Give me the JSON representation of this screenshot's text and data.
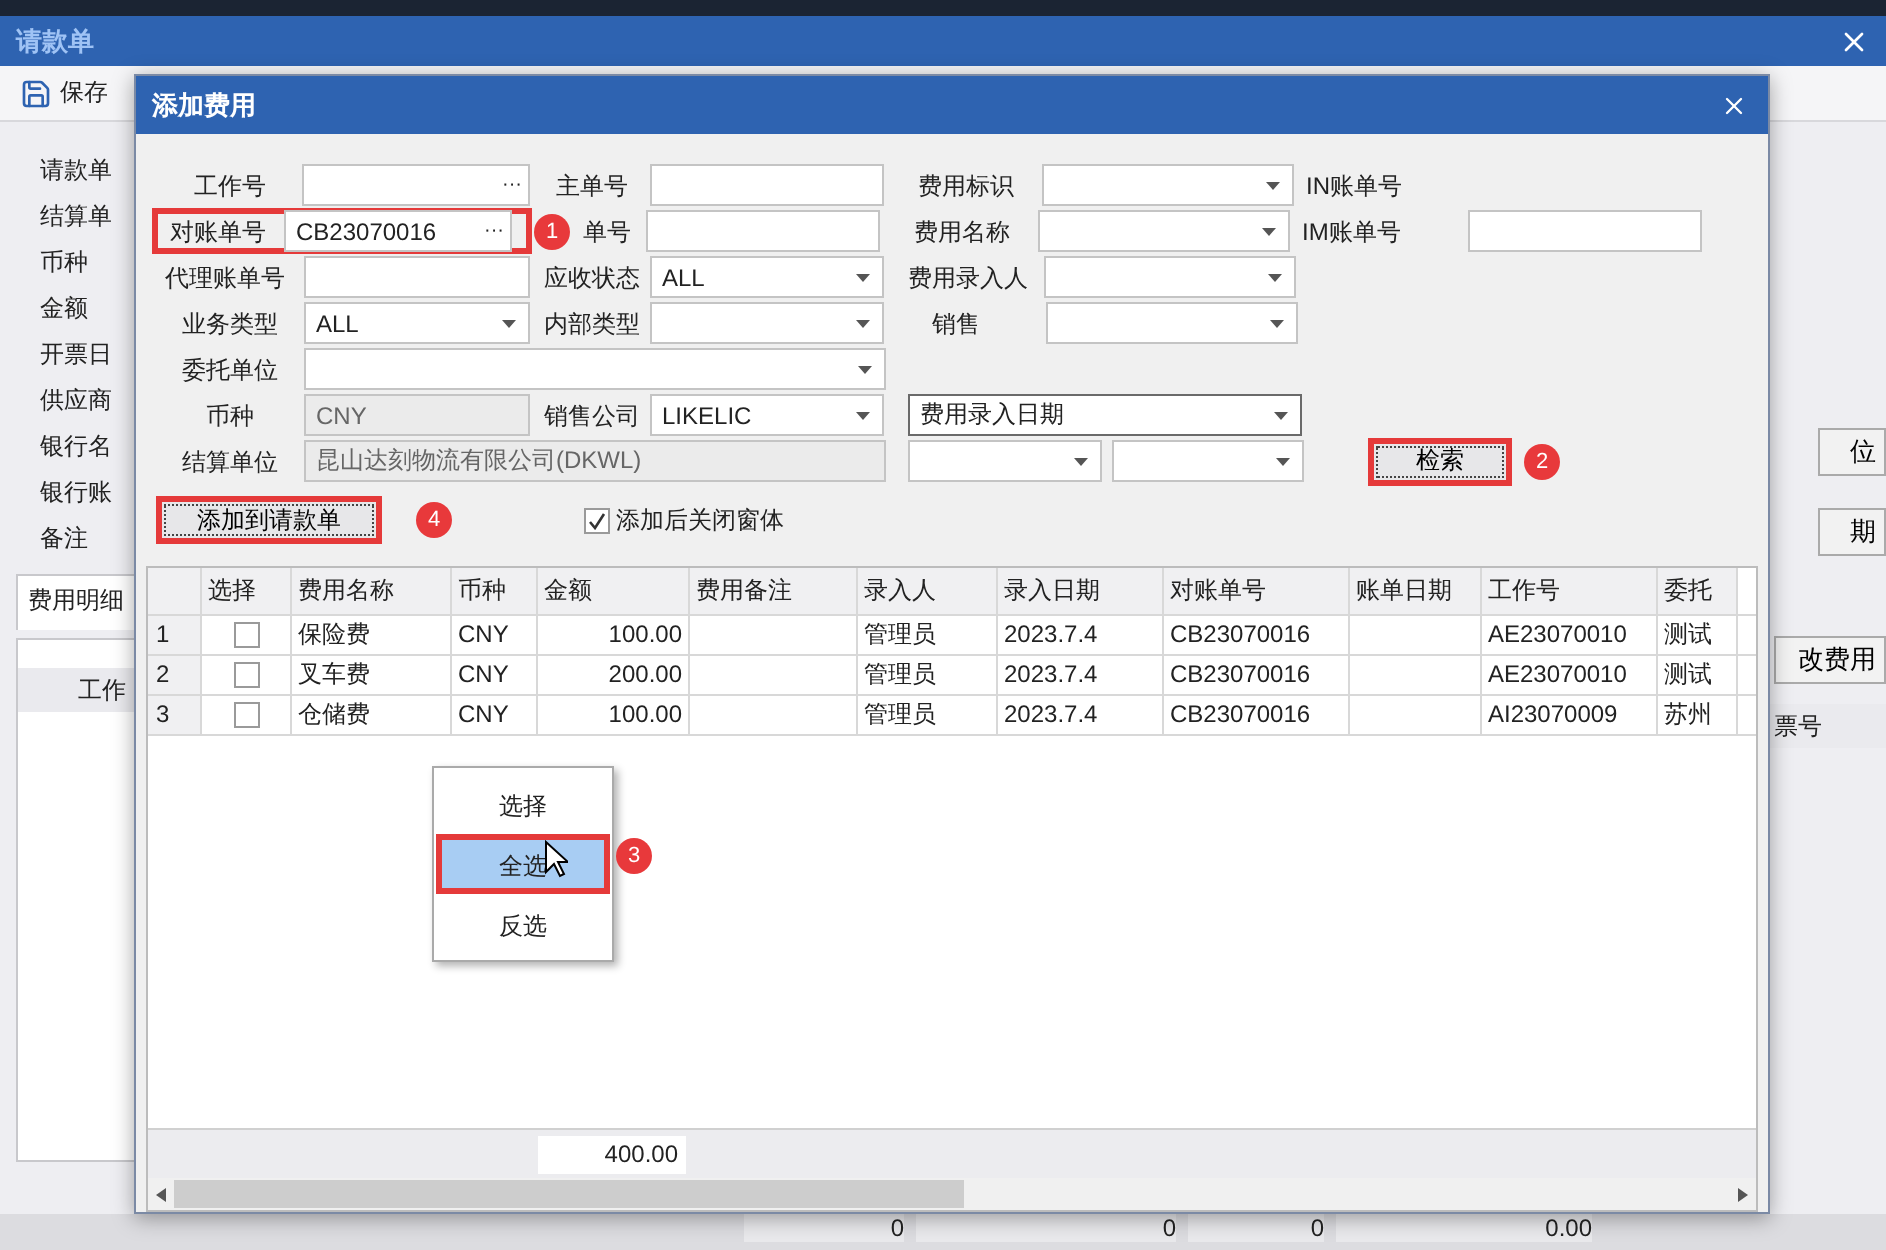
{
  "window": {
    "title": "请款单"
  },
  "toolbar": {
    "save_label": "保存"
  },
  "form_labels": [
    "请款单",
    "结算单",
    "币种",
    "金额",
    "开票日",
    "供应商",
    "银行名",
    "银行账",
    "备注"
  ],
  "side_buttons": [
    "位",
    "期"
  ],
  "tabs": [
    {
      "label": "费用明细",
      "selected": true
    }
  ],
  "modify_button": "改费用",
  "detail_columns": [
    "工作",
    "票号"
  ],
  "totals": [
    "0",
    "0",
    "0",
    "0.00"
  ],
  "dialog": {
    "title": "添加费用",
    "rows": [
      [
        {
          "kind": "label",
          "text": "工作号"
        },
        {
          "kind": "lookup",
          "button": "···"
        },
        {
          "kind": "label",
          "text": "主单号"
        },
        {
          "kind": "text"
        },
        {
          "kind": "label",
          "text": "费用标识"
        },
        {
          "kind": "combo"
        },
        {
          "kind": "label",
          "text": "IN账单号"
        }
      ],
      [
        {
          "kind": "group",
          "highlight": true,
          "children": [
            {
              "kind": "label",
              "text": "对账单号"
            },
            {
              "kind": "lookup",
              "value": "CB23070016",
              "button": "···"
            }
          ]
        },
        {
          "kind": "marker",
          "text": "1"
        },
        {
          "kind": "label",
          "text": "单号"
        },
        {
          "kind": "text"
        },
        {
          "kind": "label",
          "text": "费用名称"
        },
        {
          "kind": "combo"
        },
        {
          "kind": "label",
          "text": "IM账单号"
        },
        {
          "kind": "text"
        }
      ],
      [
        {
          "kind": "label",
          "text": "代理账单号"
        },
        {
          "kind": "text"
        },
        {
          "kind": "label",
          "text": "应收状态"
        },
        {
          "kind": "combo",
          "value": "ALL"
        },
        {
          "kind": "label",
          "text": "费用录入人"
        },
        {
          "kind": "combo"
        }
      ],
      [
        {
          "kind": "label",
          "text": "业务类型"
        },
        {
          "kind": "combo",
          "value": "ALL"
        },
        {
          "kind": "label",
          "text": "内部类型"
        },
        {
          "kind": "combo"
        },
        {
          "kind": "label",
          "text": "销售"
        },
        {
          "kind": "combo"
        }
      ],
      [
        {
          "kind": "label",
          "text": "委托单位"
        },
        {
          "kind": "combo"
        }
      ],
      [
        {
          "kind": "label",
          "text": "币种"
        },
        {
          "kind": "text",
          "value": "CNY",
          "disabled": true
        },
        {
          "kind": "label",
          "text": "销售公司"
        },
        {
          "kind": "combo",
          "value": "LIKELIC"
        },
        {
          "kind": "dropdown",
          "value": "费用录入日期"
        }
      ],
      [
        {
          "kind": "label",
          "text": "结算单位"
        },
        {
          "kind": "combo",
          "value": "昆山达刻物流有限公司(DKWL)",
          "disabled": true
        },
        {
          "kind": "combo"
        },
        {
          "kind": "combo"
        },
        {
          "kind": "button",
          "text": "检索",
          "highlight": true
        },
        {
          "kind": "marker",
          "text": "2"
        }
      ],
      [
        {
          "kind": "button",
          "text": "添加到请款单",
          "highlight": true
        },
        {
          "kind": "marker",
          "text": "4"
        },
        {
          "kind": "check",
          "text": "添加后关闭窗体",
          "checked": true
        }
      ]
    ],
    "table": {
      "select_column": "选择",
      "columns": [
        "费用名称",
        "币种",
        "金额",
        "费用备注",
        "录入人",
        "录入日期",
        "对账单号",
        "账单日期",
        "工作号",
        "委托"
      ],
      "rows": [
        {
          "index": "1",
          "checked": false,
          "cells": [
            "保险费",
            "CNY",
            "100.00",
            null,
            "管理员",
            "2023.7.4",
            "CB23070016",
            null,
            "AE23070010",
            "测试"
          ]
        },
        {
          "index": "2",
          "checked": false,
          "cells": [
            "叉车费",
            "CNY",
            "200.00",
            null,
            "管理员",
            "2023.7.4",
            "CB23070016",
            null,
            "AE23070010",
            "测试"
          ]
        },
        {
          "index": "3",
          "checked": false,
          "cells": [
            "仓储费",
            "CNY",
            "100.00",
            null,
            "管理员",
            "2023.7.4",
            "CB23070016",
            null,
            "AI23070009",
            "苏州"
          ]
        }
      ],
      "total": "400.00"
    },
    "context_menu": {
      "items": [
        {
          "label": "选择",
          "selected": false
        },
        {
          "label": "全选",
          "selected": true
        },
        {
          "label": "反选",
          "selected": false
        }
      ],
      "marker": "3"
    }
  }
}
